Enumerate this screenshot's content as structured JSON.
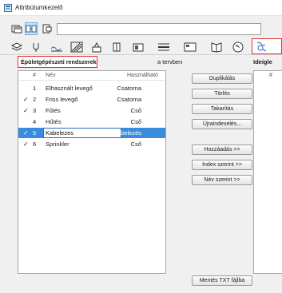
{
  "window": {
    "title": "Attribútumkezelő"
  },
  "search": {
    "value": ""
  },
  "section": {
    "label": "Épületgépészeti rendszerek",
    "in_text": "a tervben"
  },
  "right_panel": {
    "label": "Ideigle",
    "col_num": "#"
  },
  "table": {
    "headers": {
      "num": "#",
      "name": "Név",
      "type": "Használható"
    },
    "rows": [
      {
        "checked": "",
        "num": "1",
        "name": "Elhasznált levegő",
        "type": "Csatorna"
      },
      {
        "checked": "✓",
        "num": "2",
        "name": "Friss levegő",
        "type": "Csatorna"
      },
      {
        "checked": "✓",
        "num": "3",
        "name": "Fűtés",
        "type": "Cső"
      },
      {
        "checked": "",
        "num": "4",
        "name": "Hűtés",
        "type": "Cső"
      },
      {
        "checked": "✓",
        "num": "5",
        "name": "Kabelezes",
        "type": "Kabelezés"
      },
      {
        "checked": "✓",
        "num": "6",
        "name": "Sprinkler",
        "type": "Cső"
      }
    ]
  },
  "buttons": {
    "duplicate": "Duplikálás",
    "delete": "Törlés",
    "purge": "Takarítás",
    "renumber": "Újraindexelés...",
    "add": "Hozzáadás >>",
    "by_index": "Index szerint >>",
    "by_name": "Név szerint >>",
    "save_txt": "Mentés TXT fájlba"
  },
  "colors": {
    "accent": "#3a8dde",
    "highlight": "#e0312b"
  },
  "icons": {
    "toolbar": [
      "open-file-icon",
      "attribute-manager-icon",
      "copy-icon"
    ],
    "tabs": [
      "layers-icon",
      "pen-icon",
      "line-type-icon",
      "fill-icon",
      "building-material-icon",
      "composite-icon",
      "profile-icon",
      "zone-icon",
      "globe-icon",
      "mep-system-icon",
      "settings-icon"
    ]
  }
}
